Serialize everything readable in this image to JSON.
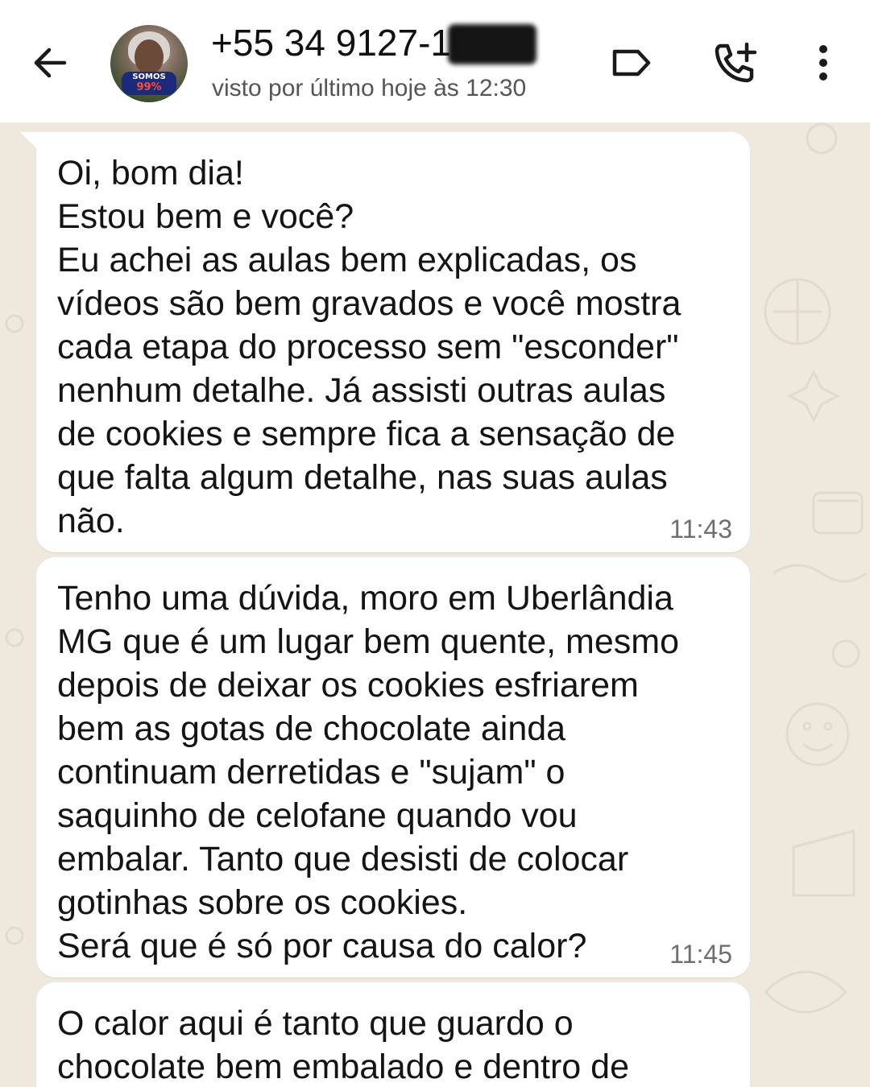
{
  "header": {
    "contact_name": "+55 34 9127-1874",
    "last_seen": "visto por último hoje às 12:30",
    "avatar_badge_top": "SOMOS",
    "avatar_badge_bottom": "99%",
    "icons": {
      "back": "back-arrow-icon",
      "label": "label-tag-icon",
      "call": "add-call-icon",
      "menu": "more-vertical-icon"
    }
  },
  "messages": [
    {
      "text": "Oi, bom dia!\nEstou bem e você?\nEu achei as aulas bem explicadas, os\nvídeos são bem gravados e você mostra\ncada etapa do processo sem \"esconder\"\nnenhum detalhe. Já assisti outras aulas\nde cookies e sempre fica a sensação de\nque falta algum detalhe, nas suas aulas\nnão.",
      "time": "11:43"
    },
    {
      "text": "Tenho uma dúvida, moro em Uberlândia\nMG que é um lugar bem quente, mesmo\ndepois de deixar os cookies esfriarem\nbem as gotas de chocolate ainda\ncontinuam derretidas e \"sujam\" o\nsaquinho de celofane quando vou\nembalar. Tanto que desisti de colocar\ngotinhas sobre os cookies.\nSerá que é só por causa do calor?",
      "time": "11:45"
    },
    {
      "text": "O calor aqui é tanto que guardo o\nchocolate bem embalado e dentro de",
      "time": ""
    }
  ],
  "colors": {
    "header_bg": "#ffffff",
    "chat_bg": "#efe8dc",
    "bubble_bg": "#ffffff",
    "text": "#141414",
    "time": "#6e6e6e"
  }
}
